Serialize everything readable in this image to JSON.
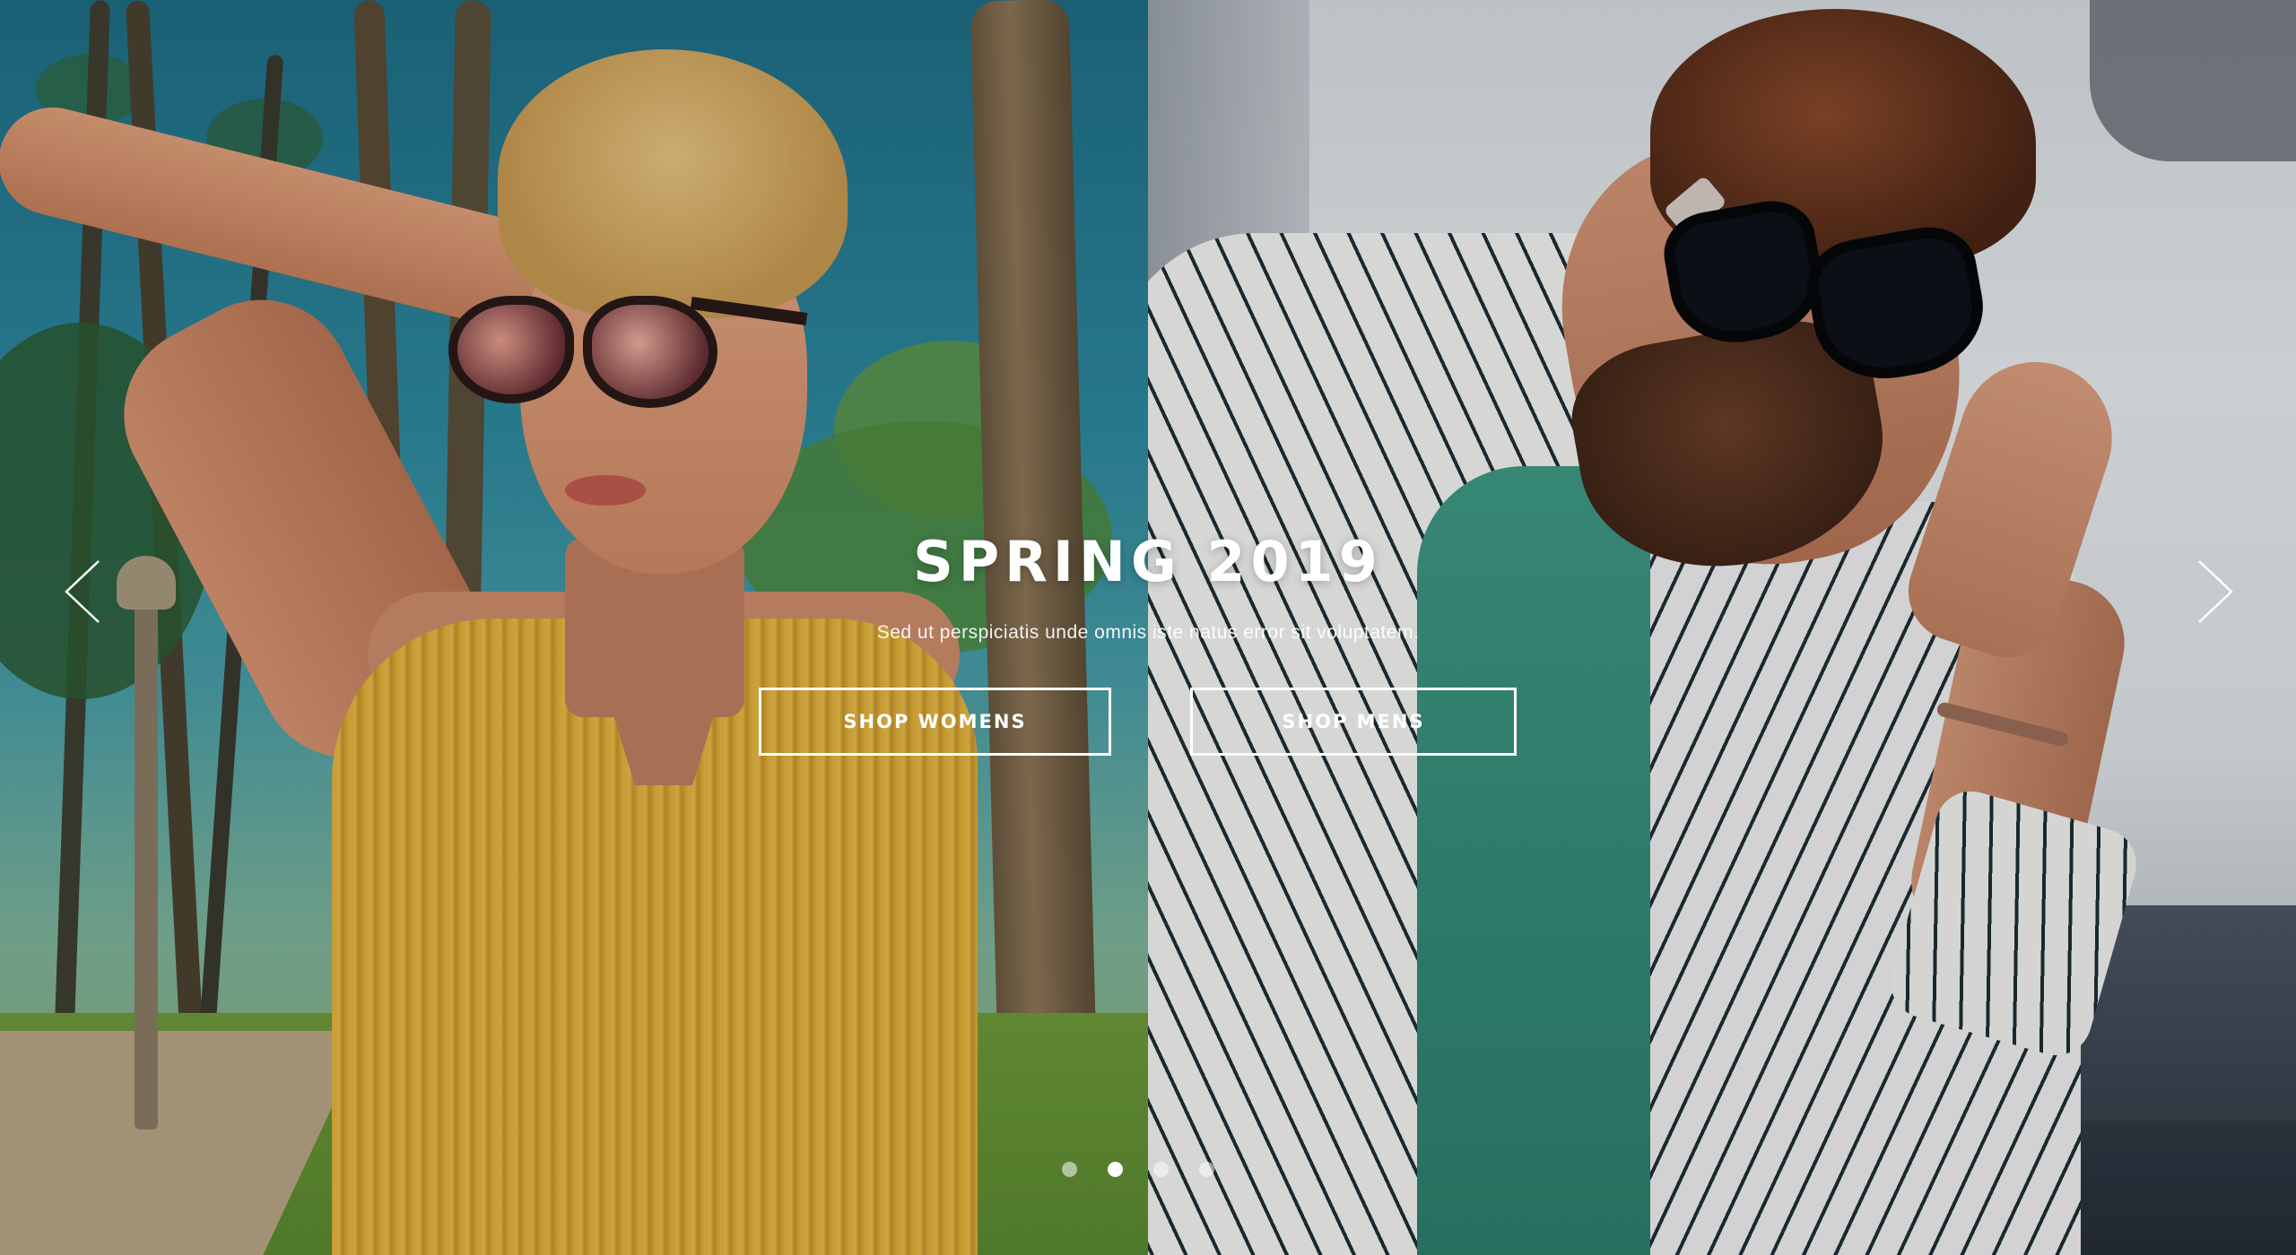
{
  "hero": {
    "title": "SPRING 2019",
    "subtitle": "Sed ut perspiciatis unde omnis iste natus error sit voluptatem.",
    "buttons": {
      "womens_label": "SHOP WOMENS",
      "mens_label": "SHOP MENS"
    },
    "navigation": {
      "prev_icon": "chevron-left-icon",
      "next_icon": "chevron-right-icon"
    },
    "pagination": {
      "total": 4,
      "active_index": 1
    },
    "colors": {
      "text": "#ffffff",
      "button_border": "#ffffff",
      "dot_inactive": "rgba(255,255,255,0.55)",
      "dot_active": "#ffffff"
    }
  }
}
